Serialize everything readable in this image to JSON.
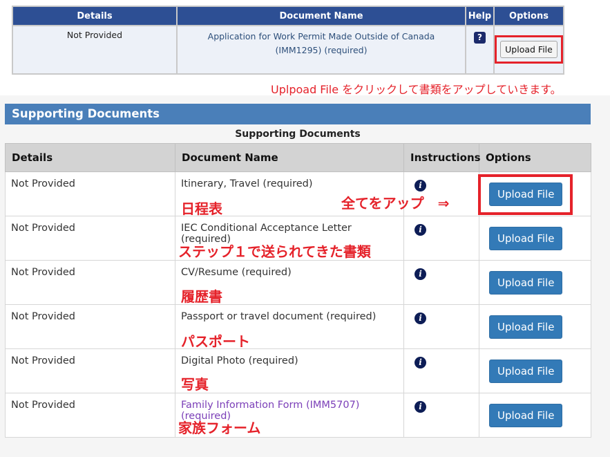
{
  "top_table": {
    "headers": [
      "Details",
      "Document Name",
      "Help",
      "Options"
    ],
    "row": {
      "details": "Not Provided",
      "doc_line1": "Application for Work Permit Made Outside of Canada",
      "doc_line2": "(IMM1295)  (required)",
      "help_icon": "?",
      "button": "Upload File"
    }
  },
  "annotations": {
    "top_note": "Uplpoad File をクリックして書類をアップしていきます。",
    "upload_all": "全てをアップ　⇒",
    "row_notes": [
      "日程表",
      "ステップ１で送られてきた書類",
      "履歴書",
      "パスポート",
      "写真",
      "家族フォーム"
    ]
  },
  "section": {
    "title": "Supporting Documents",
    "caption": "Supporting Documents"
  },
  "support_table": {
    "headers": [
      "Details",
      "Document Name",
      "Instructions",
      "Options"
    ],
    "rows": [
      {
        "details": "Not Provided",
        "doc": "Itinerary, Travel  (required)",
        "info": "i",
        "button": "Upload File"
      },
      {
        "details": "Not Provided",
        "doc": "IEC Conditional Acceptance Letter",
        "doc2": "(required)",
        "info": "i",
        "button": "Upload File"
      },
      {
        "details": "Not Provided",
        "doc": "CV/Resume  (required)",
        "info": "i",
        "button": "Upload File"
      },
      {
        "details": "Not Provided",
        "doc": "Passport or travel document  (required)",
        "info": "i",
        "button": "Upload File"
      },
      {
        "details": "Not Provided",
        "doc": "Digital Photo  (required)",
        "info": "i",
        "button": "Upload File"
      },
      {
        "details": "Not Provided",
        "doc": "Family Information Form (IMM5707)",
        "doc2": "(required)",
        "info": "i",
        "button": "Upload File"
      }
    ]
  },
  "colors": {
    "header_dark_blue": "#2d4f94",
    "section_blue": "#4a7fb9",
    "button_blue": "#337ab7",
    "annotation_red": "#e5222a",
    "link_purple": "#7b3fb8"
  },
  "icons": {
    "help": "question-mark-icon",
    "instructions": "info-icon"
  }
}
